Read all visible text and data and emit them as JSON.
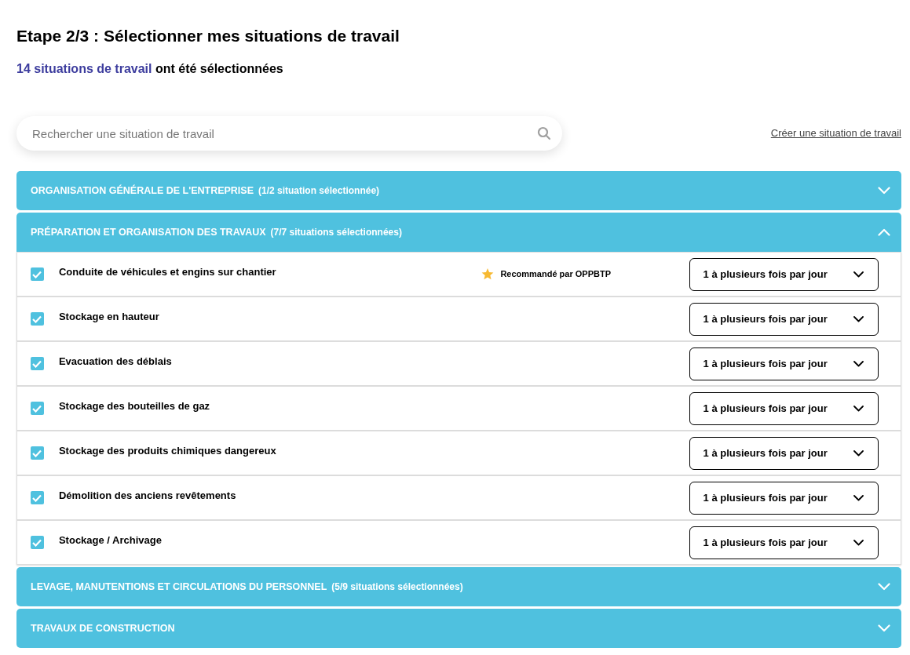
{
  "title": "Etape 2/3 : Sélectionner mes situations de travail",
  "summary": {
    "highlight": "14 situations de travail",
    "rest": "ont été sélectionnées"
  },
  "search": {
    "placeholder": "Rechercher une situation de travail"
  },
  "create_link": "Créer une situation de travail",
  "sections": [
    {
      "title": "ORGANISATION GÉNÉRALE DE L'ENTREPRISE",
      "count": "(1/2 situation sélectionnée)",
      "expanded": false
    },
    {
      "title": "PRÉPARATION ET ORGANISATION DES TRAVAUX",
      "count": "(7/7 situations sélectionnées)",
      "expanded": true,
      "items": [
        {
          "label": "Conduite de véhicules et engins sur chantier",
          "checked": true,
          "recommendation": "Recommandé par OPPBTP",
          "frequency": "1 à plusieurs fois par jour"
        },
        {
          "label": "Stockage en hauteur",
          "checked": true,
          "frequency": "1 à plusieurs fois par jour"
        },
        {
          "label": "Evacuation des déblais",
          "checked": true,
          "frequency": "1 à plusieurs fois par jour"
        },
        {
          "label": "Stockage des bouteilles de gaz",
          "checked": true,
          "frequency": "1 à plusieurs fois par jour"
        },
        {
          "label": "Stockage des produits chimiques dangereux",
          "checked": true,
          "frequency": "1 à plusieurs fois par jour"
        },
        {
          "label": "Démolition des anciens revêtements",
          "checked": true,
          "frequency": "1 à plusieurs fois par jour"
        },
        {
          "label": "Stockage / Archivage",
          "checked": true,
          "frequency": "1 à plusieurs fois par jour"
        }
      ]
    },
    {
      "title": "LEVAGE, MANUTENTIONS ET CIRCULATIONS DU PERSONNEL",
      "count": "(5/9 situations sélectionnées)",
      "expanded": false
    },
    {
      "title": "TRAVAUX DE CONSTRUCTION",
      "expanded": false
    }
  ]
}
